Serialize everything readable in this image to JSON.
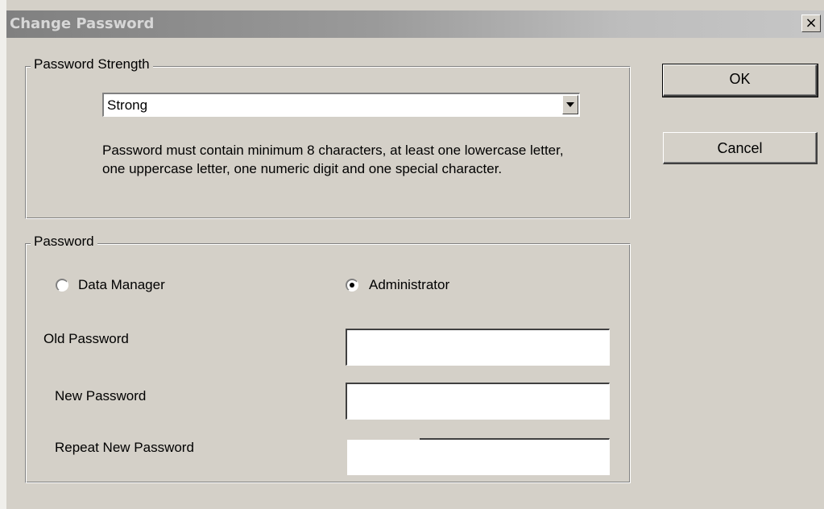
{
  "window": {
    "title": "Change Password",
    "close_label": "×"
  },
  "strength_group": {
    "legend": "Password Strength",
    "selected": "Strong",
    "description": "Password must contain minimum 8 characters, at least one lowercase letter, one uppercase letter, one numeric digit and one special character."
  },
  "password_group": {
    "legend": "Password",
    "radio_data_manager": "Data Manager",
    "radio_administrator": "Administrator",
    "selected_role": "Administrator",
    "old_password_label": "Old Password",
    "new_password_label": "New Password",
    "repeat_password_label": "Repeat New Password",
    "old_password_value": "",
    "new_password_value": "",
    "repeat_password_value": ""
  },
  "buttons": {
    "ok": "OK",
    "cancel": "Cancel"
  }
}
